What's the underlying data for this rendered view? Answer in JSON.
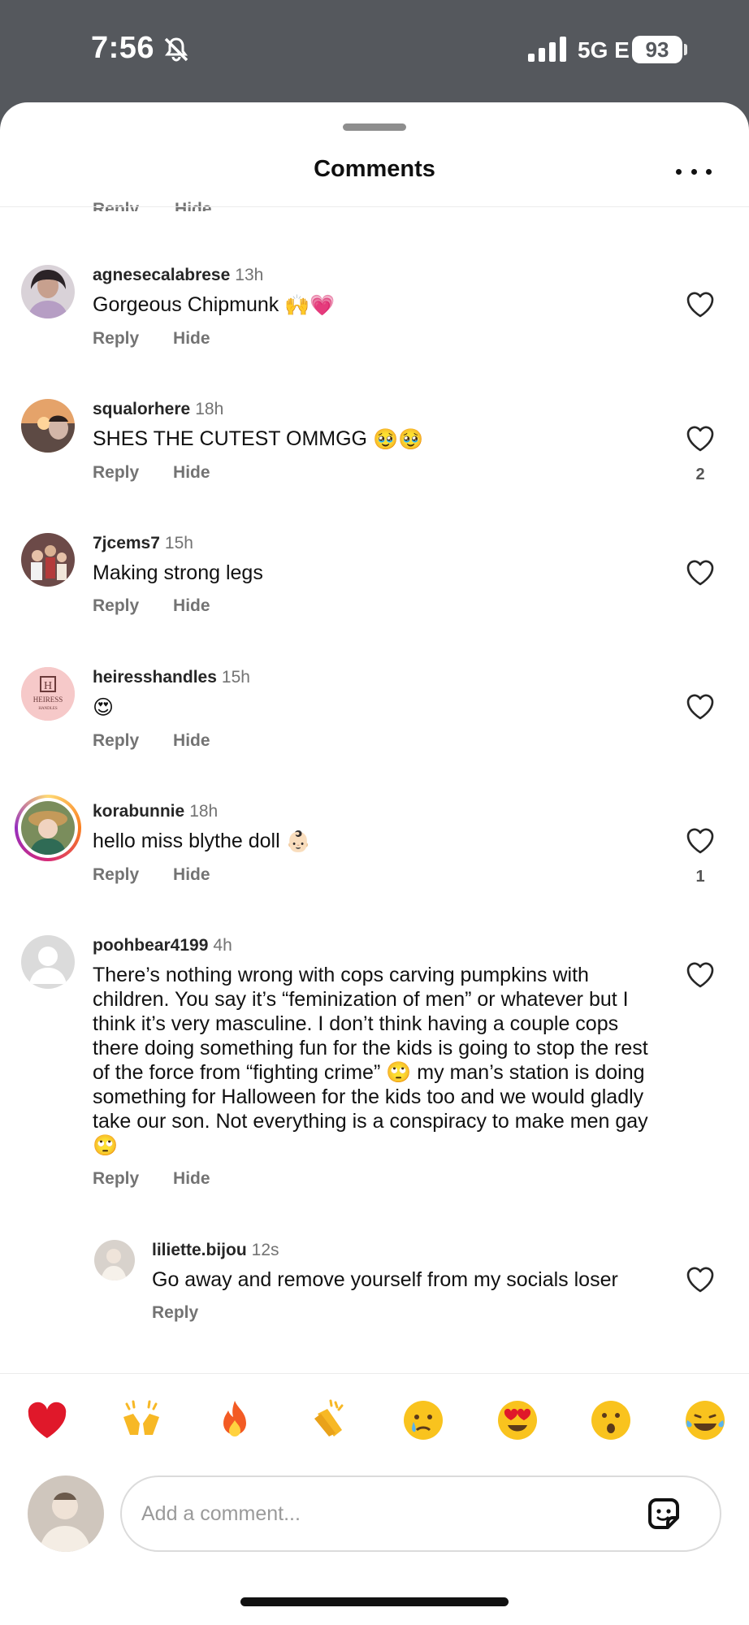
{
  "status_bar": {
    "time": "7:56",
    "network": "5G E",
    "battery": "93"
  },
  "sheet": {
    "title": "Comments",
    "peek_actions": [
      "Reply",
      "Hide"
    ]
  },
  "comments": [
    {
      "username": "agnesecalabrese",
      "time": "13h",
      "text": "Gorgeous Chipmunk",
      "emojis": [
        "🙌",
        "💗"
      ],
      "actions": [
        "Reply",
        "Hide"
      ],
      "likes": ""
    },
    {
      "username": "squalorhere",
      "time": "18h",
      "text": "SHES THE CUTEST OMMGG",
      "emojis": [
        "🥹",
        "🥹"
      ],
      "actions": [
        "Reply",
        "Hide"
      ],
      "likes": "2"
    },
    {
      "username": "7jcems7",
      "time": "15h",
      "text": "Making strong legs",
      "emojis": [],
      "actions": [
        "Reply",
        "Hide"
      ],
      "likes": ""
    },
    {
      "username": "heiresshandles",
      "time": "15h",
      "text": "",
      "emojis": [
        "😍"
      ],
      "actions": [
        "Reply",
        "Hide"
      ],
      "likes": "",
      "avatar_text": {
        "top": "HEIRESS",
        "bottom": "HANDLES"
      }
    },
    {
      "username": "korabunnie",
      "time": "18h",
      "text": "hello miss blythe doll",
      "emojis": [
        "👶🏻"
      ],
      "actions": [
        "Reply",
        "Hide"
      ],
      "likes": "1"
    },
    {
      "username": "poohbear4199",
      "time": "4h",
      "text": "There’s nothing wrong with cops carving pumpkins with children. You say it’s “feminization of men” or whatever but I think it’s very masculine. I don’t think having a couple cops there doing something fun for the kids is going to stop the rest of the force from “fighting crime” 🙄 my man’s station is doing something for Halloween for the kids too and we would gladly take our son. Not everything is a conspiracy to make men gay 🙄",
      "emojis": [],
      "actions": [
        "Reply",
        "Hide"
      ],
      "likes": ""
    },
    {
      "username": "liliette.bijou",
      "time": "12s",
      "text": "Go away and remove yourself from my socials loser",
      "emojis": [],
      "actions": [
        "Reply"
      ],
      "likes": "",
      "is_reply": true
    }
  ],
  "reactions": [
    "❤️",
    "🙌",
    "🔥",
    "👏",
    "😢",
    "😍",
    "😮",
    "😂"
  ],
  "composer": {
    "placeholder": "Add a comment..."
  },
  "colors": {
    "status_bar_bg": "#55585d",
    "secondary_text": "#737373",
    "story_ring": [
      "#feda75",
      "#d62976",
      "#962fbf"
    ]
  }
}
